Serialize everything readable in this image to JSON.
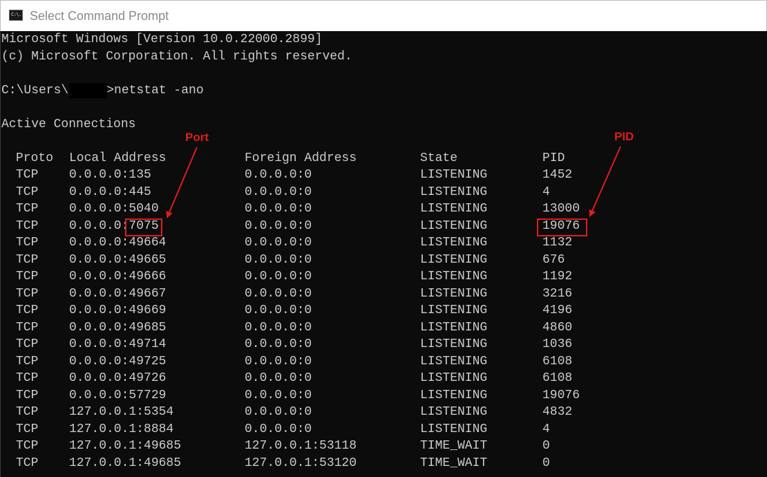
{
  "window": {
    "title": "Select Command Prompt",
    "icon": "cmd-console-icon",
    "icon_text": "C:\\."
  },
  "console": {
    "banner_line1": "Microsoft Windows [Version 10.0.22000.2899]",
    "banner_line2": "(c) Microsoft Corporation. All rights reserved.",
    "prompt_prefix": "C:\\Users\\",
    "prompt_suffix": ">netstat -ano",
    "section_title": "Active Connections",
    "headers": {
      "proto": "Proto",
      "local": "Local Address",
      "foreign": "Foreign Address",
      "state": "State",
      "pid": "PID"
    },
    "rows": [
      {
        "proto": "TCP",
        "local": "0.0.0.0:135",
        "foreign": "0.0.0.0:0",
        "state": "LISTENING",
        "pid": "1452"
      },
      {
        "proto": "TCP",
        "local": "0.0.0.0:445",
        "foreign": "0.0.0.0:0",
        "state": "LISTENING",
        "pid": "4"
      },
      {
        "proto": "TCP",
        "local": "0.0.0.0:5040",
        "foreign": "0.0.0.0:0",
        "state": "LISTENING",
        "pid": "13000"
      },
      {
        "proto": "TCP",
        "local": "0.0.0.0:7075",
        "foreign": "0.0.0.0:0",
        "state": "LISTENING",
        "pid": "19076"
      },
      {
        "proto": "TCP",
        "local": "0.0.0.0:49664",
        "foreign": "0.0.0.0:0",
        "state": "LISTENING",
        "pid": "1132"
      },
      {
        "proto": "TCP",
        "local": "0.0.0.0:49665",
        "foreign": "0.0.0.0:0",
        "state": "LISTENING",
        "pid": "676"
      },
      {
        "proto": "TCP",
        "local": "0.0.0.0:49666",
        "foreign": "0.0.0.0:0",
        "state": "LISTENING",
        "pid": "1192"
      },
      {
        "proto": "TCP",
        "local": "0.0.0.0:49667",
        "foreign": "0.0.0.0:0",
        "state": "LISTENING",
        "pid": "3216"
      },
      {
        "proto": "TCP",
        "local": "0.0.0.0:49669",
        "foreign": "0.0.0.0:0",
        "state": "LISTENING",
        "pid": "4196"
      },
      {
        "proto": "TCP",
        "local": "0.0.0.0:49685",
        "foreign": "0.0.0.0:0",
        "state": "LISTENING",
        "pid": "4860"
      },
      {
        "proto": "TCP",
        "local": "0.0.0.0:49714",
        "foreign": "0.0.0.0:0",
        "state": "LISTENING",
        "pid": "1036"
      },
      {
        "proto": "TCP",
        "local": "0.0.0.0:49725",
        "foreign": "0.0.0.0:0",
        "state": "LISTENING",
        "pid": "6108"
      },
      {
        "proto": "TCP",
        "local": "0.0.0.0:49726",
        "foreign": "0.0.0.0:0",
        "state": "LISTENING",
        "pid": "6108"
      },
      {
        "proto": "TCP",
        "local": "0.0.0.0:57729",
        "foreign": "0.0.0.0:0",
        "state": "LISTENING",
        "pid": "19076"
      },
      {
        "proto": "TCP",
        "local": "127.0.0.1:5354",
        "foreign": "0.0.0.0:0",
        "state": "LISTENING",
        "pid": "4832"
      },
      {
        "proto": "TCP",
        "local": "127.0.0.1:8884",
        "foreign": "0.0.0.0:0",
        "state": "LISTENING",
        "pid": "4"
      },
      {
        "proto": "TCP",
        "local": "127.0.0.1:49685",
        "foreign": "127.0.0.1:53118",
        "state": "TIME_WAIT",
        "pid": "0"
      },
      {
        "proto": "TCP",
        "local": "127.0.0.1:49685",
        "foreign": "127.0.0.1:53120",
        "state": "TIME_WAIT",
        "pid": "0"
      }
    ]
  },
  "annotations": {
    "port_label": "Port",
    "pid_label": "PID",
    "color": "#e01b1b"
  },
  "colors": {
    "console_bg": "#0c0c0c",
    "console_text": "#cccccc",
    "titlebar_bg": "#ffffff",
    "title_text": "#8a8a8a"
  }
}
